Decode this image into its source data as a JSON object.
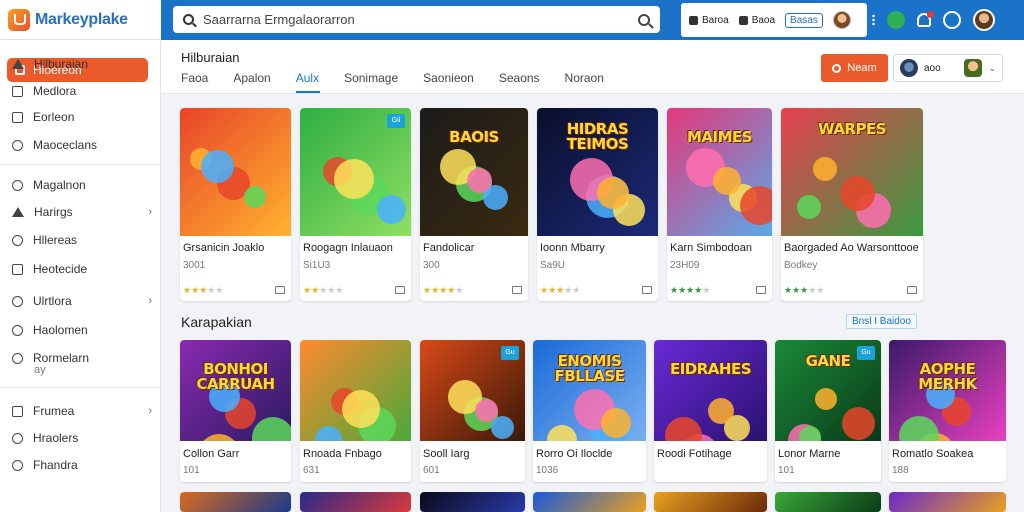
{
  "app": {
    "title": "Markeyplake",
    "search_placeholder": "Saarrarna Ermgalaorarron",
    "userbox": {
      "item1": "Baroa",
      "item2": "Baoa",
      "button": "Basas"
    }
  },
  "sidebar": {
    "active": "Hloereon",
    "items": [
      {
        "label": "Hilburaian",
        "icon": "triangle-icon"
      },
      {
        "label": "Medlora",
        "icon": "tag-icon"
      },
      {
        "label": "Eorleon",
        "icon": "box-icon"
      },
      {
        "label": "Maoceclans",
        "icon": "list-icon"
      },
      {
        "label": "Magalnon",
        "icon": "circle-icon"
      },
      {
        "label": "Harirgs",
        "icon": "triangle-icon",
        "chevron": "›"
      },
      {
        "label": "Hllereas",
        "icon": "clock-icon"
      },
      {
        "label": "Heotecide",
        "icon": "grid-icon"
      },
      {
        "label": "Ulrtlora",
        "icon": "circle-icon",
        "chevron": "›"
      },
      {
        "label": "Haolomen",
        "icon": "list-icon"
      },
      {
        "label": "Rormelarn",
        "icon": "circle-icon",
        "sub": "ay"
      },
      {
        "label": "Frumea",
        "icon": "grid-icon",
        "chevron": "›"
      },
      {
        "label": "Hraolers",
        "icon": "clock-icon"
      },
      {
        "label": "Fhandra",
        "icon": "circle-icon"
      }
    ]
  },
  "header": {
    "title": "Hilburaian",
    "tabs": [
      "Faoa",
      "Apalon",
      "Aulx",
      "Sonimage",
      "Saonieon",
      "Seaons",
      "Noraon"
    ],
    "active_tab": 2,
    "action_button": "Neam",
    "user_label": "aoo",
    "dropdown": "⌄"
  },
  "row1": [
    {
      "name": "Grsanicin Joaklo",
      "sub": "3001",
      "stars": 3,
      "star_color": "gold",
      "colors": [
        "#e8452a",
        "#ffb22e"
      ],
      "art": "",
      "badge": ""
    },
    {
      "name": "Roogagn Inlauaon",
      "sub": "Si1U3",
      "stars": 2,
      "star_color": "gold",
      "colors": [
        "#2fae44",
        "#8fe060"
      ],
      "art": "",
      "badge": "Gil"
    },
    {
      "name": "Fandolicar",
      "sub": "300",
      "stars": 4,
      "star_color": "gold",
      "colors": [
        "#1b1b1b",
        "#3a2a10"
      ],
      "art": "BAOIS",
      "badge": ""
    },
    {
      "name": "Ioonn Mbarry",
      "sub": "Sa9U",
      "stars": 3,
      "star_color": "gold",
      "colors": [
        "#0a0f2a",
        "#1c2a7a"
      ],
      "art": "HIDRAS TEIMOS",
      "badge": ""
    },
    {
      "name": "Karn Simbodoan",
      "sub": "23H09",
      "stars": 4,
      "star_color": "green",
      "colors": [
        "#e4387a",
        "#5aaae8"
      ],
      "art": "MAIMES",
      "badge": ""
    },
    {
      "name": "Baorgaded Ao Warsonttooe",
      "sub": "Bodkey",
      "stars": 3,
      "star_color": "green",
      "colors": [
        "#e84050",
        "#3a9a40"
      ],
      "art": "WARPES",
      "badge": ""
    }
  ],
  "section": {
    "title": "Karapakian",
    "link": "Bnsl I Baidoo"
  },
  "row2": [
    {
      "name": "Collon Garr",
      "sub": "101",
      "colors": [
        "#8a2ab0",
        "#2a1a60"
      ],
      "art": "BONHOI CARRUAH",
      "badge": ""
    },
    {
      "name": "Rnoada Fnbago",
      "sub": "631",
      "colors": [
        "#ff8a30",
        "#4aa838"
      ],
      "art": "",
      "badge": ""
    },
    {
      "name": "Sooll Iarg",
      "sub": "601",
      "colors": [
        "#d84a18",
        "#3a1808"
      ],
      "art": "",
      "badge": "Gu"
    },
    {
      "name": "Rorro Oi Iloclde",
      "sub": "1036",
      "colors": [
        "#1a6ad8",
        "#7ab0f0"
      ],
      "art": "ENOMIS FBLLASE",
      "badge": ""
    },
    {
      "name": "Roodi Fotihage",
      "sub": "",
      "colors": [
        "#6a2ad8",
        "#2a1070"
      ],
      "art": "EIDRAHES",
      "badge": ""
    },
    {
      "name": "Lonor Marne",
      "sub": "101",
      "colors": [
        "#1a8a38",
        "#0a3a18"
      ],
      "art": "GANE",
      "badge": "Gu"
    },
    {
      "name": "Romatlo Soakea",
      "sub": "188",
      "colors": [
        "#3a1a6a",
        "#e840c0"
      ],
      "art": "AOPHE MERHK",
      "badge": ""
    }
  ],
  "row3_colors": [
    [
      "#d86a20",
      "#1a3a8a"
    ],
    [
      "#2a2a8a",
      "#d83a3a"
    ],
    [
      "#0a0a1a",
      "#2a3aa8"
    ],
    [
      "#1a5ad8",
      "#e8a020"
    ],
    [
      "#e8a020",
      "#6a2a08"
    ],
    [
      "#3aa838",
      "#0a3a18"
    ],
    [
      "#6a2ac8",
      "#e8a020"
    ]
  ]
}
